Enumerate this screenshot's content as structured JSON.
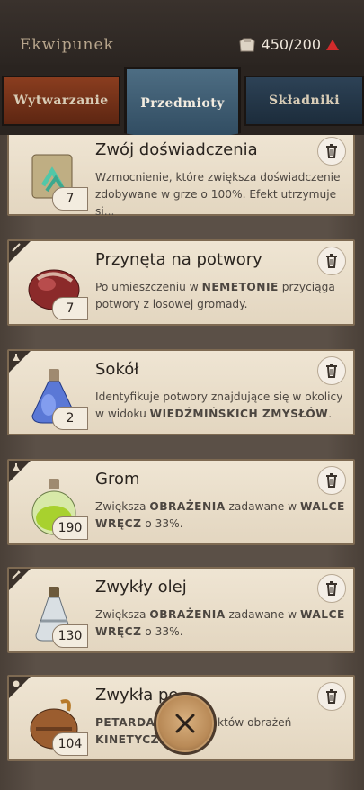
{
  "header": {
    "title": "Ekwipunek",
    "capacity": "450/200",
    "colors": {
      "bar": "#2b2521",
      "warning": "#c62828"
    }
  },
  "tabs": [
    {
      "label": "Wytwarzanie"
    },
    {
      "label": "Przedmioty"
    },
    {
      "label": "Składniki"
    }
  ],
  "items": [
    {
      "name": "Zwój doświadczenia",
      "qty": "7",
      "desc": [
        {
          "t": "Wzmocnienie, które zwiększa doświadczenie zdobywane w grze o 100%. Efekt utrzymuje si...",
          "b": false
        }
      ],
      "icon": "scroll-icon"
    },
    {
      "name": "Przynęta na potwory",
      "qty": "7",
      "desc": [
        {
          "t": "Po umieszczeniu w ",
          "b": false
        },
        {
          "t": "NEMETONIE",
          "b": true
        },
        {
          "t": " przyciąga potwory z losowej gromady.",
          "b": false
        }
      ],
      "icon": "bait-icon"
    },
    {
      "name": "Sokół",
      "qty": "2",
      "desc": [
        {
          "t": "Identyfikuje potwory znajdujące się w okolicy w widoku ",
          "b": false
        },
        {
          "t": "WIEDŹMIŃSKICH ZMYSŁÓW",
          "b": true
        },
        {
          "t": ".",
          "b": false
        }
      ],
      "icon": "blue-potion-icon"
    },
    {
      "name": "Grom",
      "qty": "190",
      "desc": [
        {
          "t": "Zwiększa ",
          "b": false
        },
        {
          "t": "OBRAŻENIA",
          "b": true
        },
        {
          "t": " zadawane w ",
          "b": false
        },
        {
          "t": "WALCE WRĘCZ",
          "b": true
        },
        {
          "t": " o 33%.",
          "b": false
        }
      ],
      "icon": "green-potion-icon"
    },
    {
      "name": "Zwykły olej",
      "qty": "130",
      "desc": [
        {
          "t": "Zwiększa ",
          "b": false
        },
        {
          "t": "OBRAŻENIA",
          "b": true
        },
        {
          "t": " zadawane w ",
          "b": false
        },
        {
          "t": "WALCE WRĘCZ",
          "b": true
        },
        {
          "t": " o 33%.",
          "b": false
        }
      ],
      "icon": "oil-flask-icon"
    },
    {
      "name": "Zwykła pe",
      "qty": "104",
      "desc": [
        {
          "t": "PETARDA",
          "b": true
        },
        {
          "t": ",",
          "b": false
        },
        {
          "t": "      e 525 punktów obrażeń",
          "b": false
        },
        {
          "t": " KINETYCZN",
          "b": true
        }
      ],
      "icon": "bomb-icon"
    }
  ]
}
